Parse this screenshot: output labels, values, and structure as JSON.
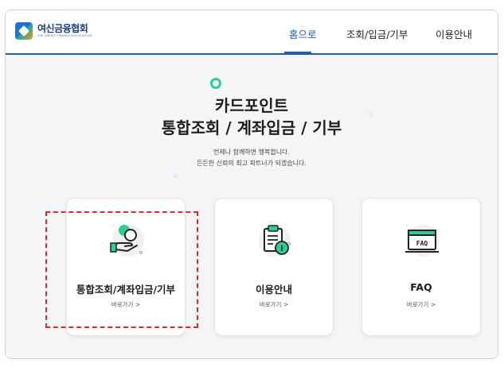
{
  "header": {
    "logo_ko": "여신금융협회",
    "logo_en": "THE CREDIT FINANCE ASSOCIATION",
    "nav": {
      "home": "홈으로",
      "inquiry": "조회/입금/기부",
      "guide": "이용안내"
    }
  },
  "hero": {
    "title_line1": "카드포인트",
    "title_line2": "통합조회 / 계좌입금 / 기부",
    "subtitle_line1": "언제나 함께하면 행복합니다.",
    "subtitle_line2": "든든한 신뢰의 최고 파트너가 되겠습니다."
  },
  "cards": [
    {
      "title": "통합조회/계좌입금/기부",
      "link": "바로가기 >",
      "icon": "coin-hand-icon"
    },
    {
      "title": "이용안내",
      "link": "바로가기 >",
      "icon": "clipboard-info-icon"
    },
    {
      "title": "FAQ",
      "link": "바로가기 >",
      "icon": "faq-window-icon"
    }
  ],
  "colors": {
    "accent": "#1d5fb0",
    "green": "#2ecf8e",
    "highlight": "#e0282a",
    "background": "#f4f5f7"
  }
}
